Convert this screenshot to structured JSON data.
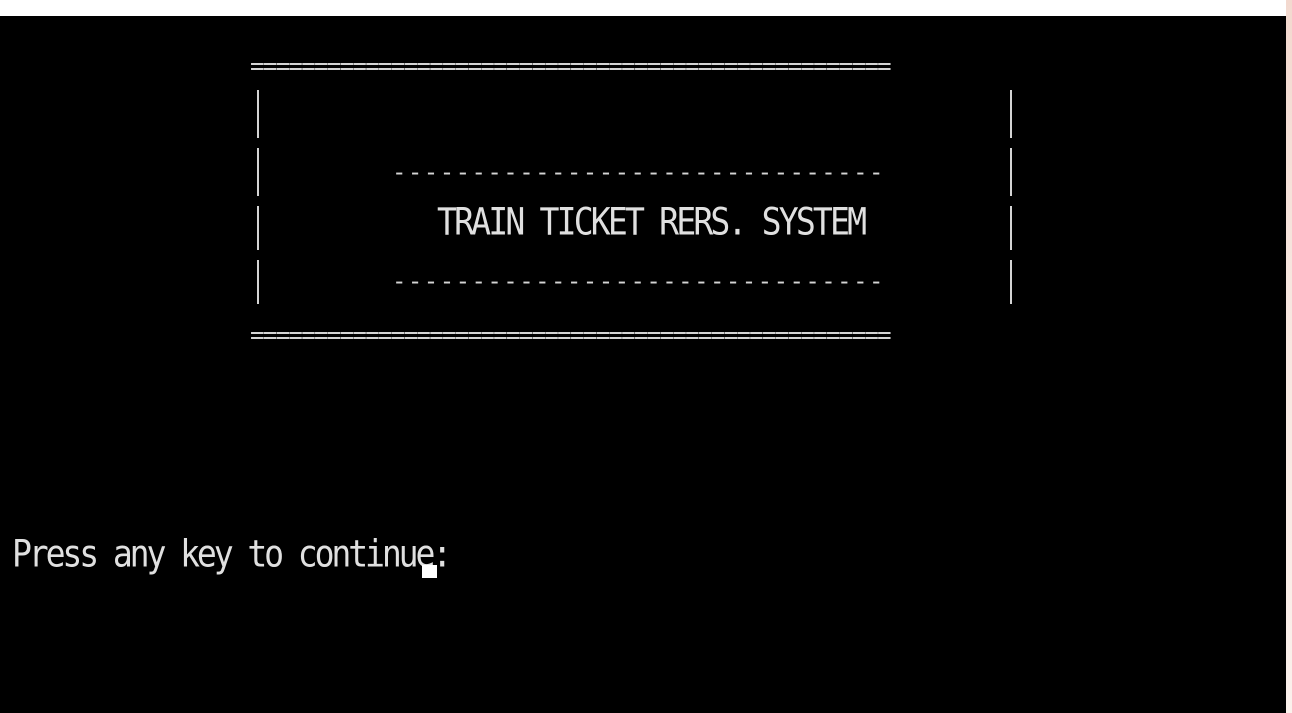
{
  "console": {
    "border_top": "==================================================",
    "border_bottom": "==================================================",
    "title_rule_top": "-------------------------------",
    "title": "TRAIN TICKET RERS. SYSTEM",
    "title_rule_bottom": "-------------------------------",
    "prompt": "Press any key to continue:",
    "colors": {
      "background": "#000000",
      "text": "#d4d4d4"
    }
  }
}
